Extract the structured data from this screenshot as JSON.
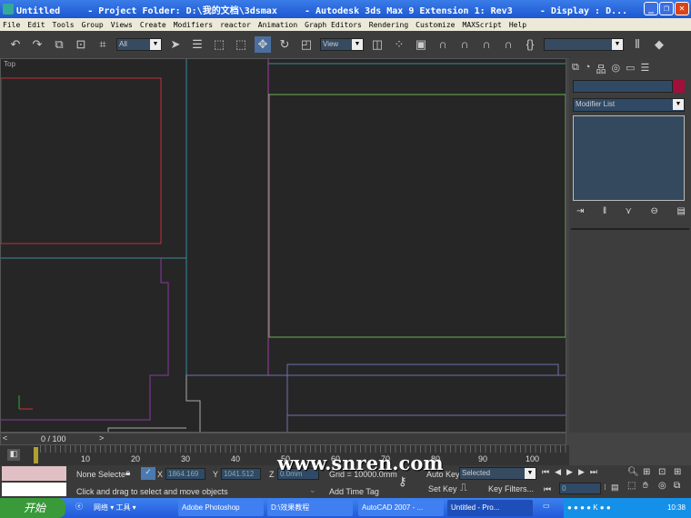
{
  "titlebar": {
    "text": "Untitled     - Project Folder: D:\\我的文档\\3dsmax     - Autodesk 3ds Max 9 Extension 1: Rev3     - Display : D...",
    "minimize": "_",
    "restore": "❐",
    "close": "✕"
  },
  "menu": [
    "File",
    "Edit",
    "Tools",
    "Group",
    "Views",
    "Create",
    "Modifiers",
    "reactor",
    "Animation",
    "Graph Editors",
    "Rendering",
    "Customize",
    "MAXScript",
    "Help"
  ],
  "toolbar": {
    "selection_filter": "All",
    "ref_coord": "View",
    "named_selection": ""
  },
  "viewport": {
    "label": "Top"
  },
  "command_panel": {
    "name_field": "",
    "color_swatch": "#a0103a",
    "modifier_list": "Modifier List"
  },
  "timeslider": {
    "position": "0 / 100",
    "prev": "<",
    "next": ">"
  },
  "ruler": {
    "ticks": [
      "10",
      "20",
      "30",
      "40",
      "50",
      "60",
      "70",
      "80",
      "90",
      "100"
    ]
  },
  "status": {
    "selection": "None Selecte",
    "x_label": "X",
    "x_value": "1864.169",
    "y_label": "Y",
    "y_value": "1041.512",
    "z_label": "Z",
    "z_value": "0.0mm",
    "grid": "Grid = 10000.0mm",
    "prompt": "Click and drag to select and move objects",
    "add_time_tag": "Add Time Tag",
    "auto_key": "Auto Key",
    "set_key": "Set Key",
    "key_mode": "Selected",
    "key_filters": "Key Filters...",
    "frame": "0"
  },
  "watermark": "www.snren.com",
  "taskbar": {
    "start": "开始",
    "quicklaunch": "网络 ▾ 工具 ▾",
    "tasks": [
      "Adobe Photoshop",
      "D:\\效果教程",
      "AutoCAD 2007 - ...",
      "Untitled     - Pro..."
    ],
    "clock": "10:38"
  }
}
